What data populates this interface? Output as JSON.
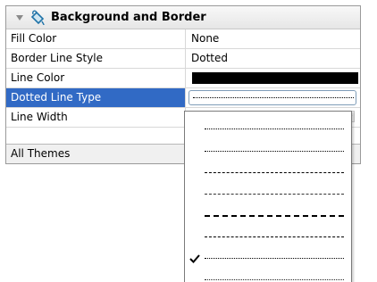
{
  "group": {
    "title": "Background and Border",
    "arrow_icon": "collapse-triangle-icon",
    "icon": "paint-bucket-icon"
  },
  "properties": [
    {
      "name": "Fill Color",
      "value": "None"
    },
    {
      "name": "Border Line Style",
      "value": "Dotted"
    },
    {
      "name": "Line Color",
      "value": "",
      "swatch_color": "#000000"
    },
    {
      "name": "Dotted Line Type",
      "value": "",
      "selected": true
    },
    {
      "name": "Line Width",
      "value": ""
    }
  ],
  "footer": {
    "label": "All Themes"
  },
  "dropdown": {
    "options": [
      {
        "style": "sparse-dots",
        "checked": false
      },
      {
        "style": "dense-dots",
        "checked": false
      },
      {
        "style": "dashes",
        "checked": false
      },
      {
        "style": "short-dash-dot",
        "checked": false
      },
      {
        "style": "long-dashes",
        "checked": false
      },
      {
        "style": "medium-dashes",
        "checked": false
      },
      {
        "style": "fine-dots",
        "checked": true
      },
      {
        "style": "very-fine-dots",
        "checked": false
      }
    ]
  },
  "colors": {
    "selection": "#316ac5",
    "grid_border": "#9a9a9a",
    "line_color": "#000000"
  }
}
